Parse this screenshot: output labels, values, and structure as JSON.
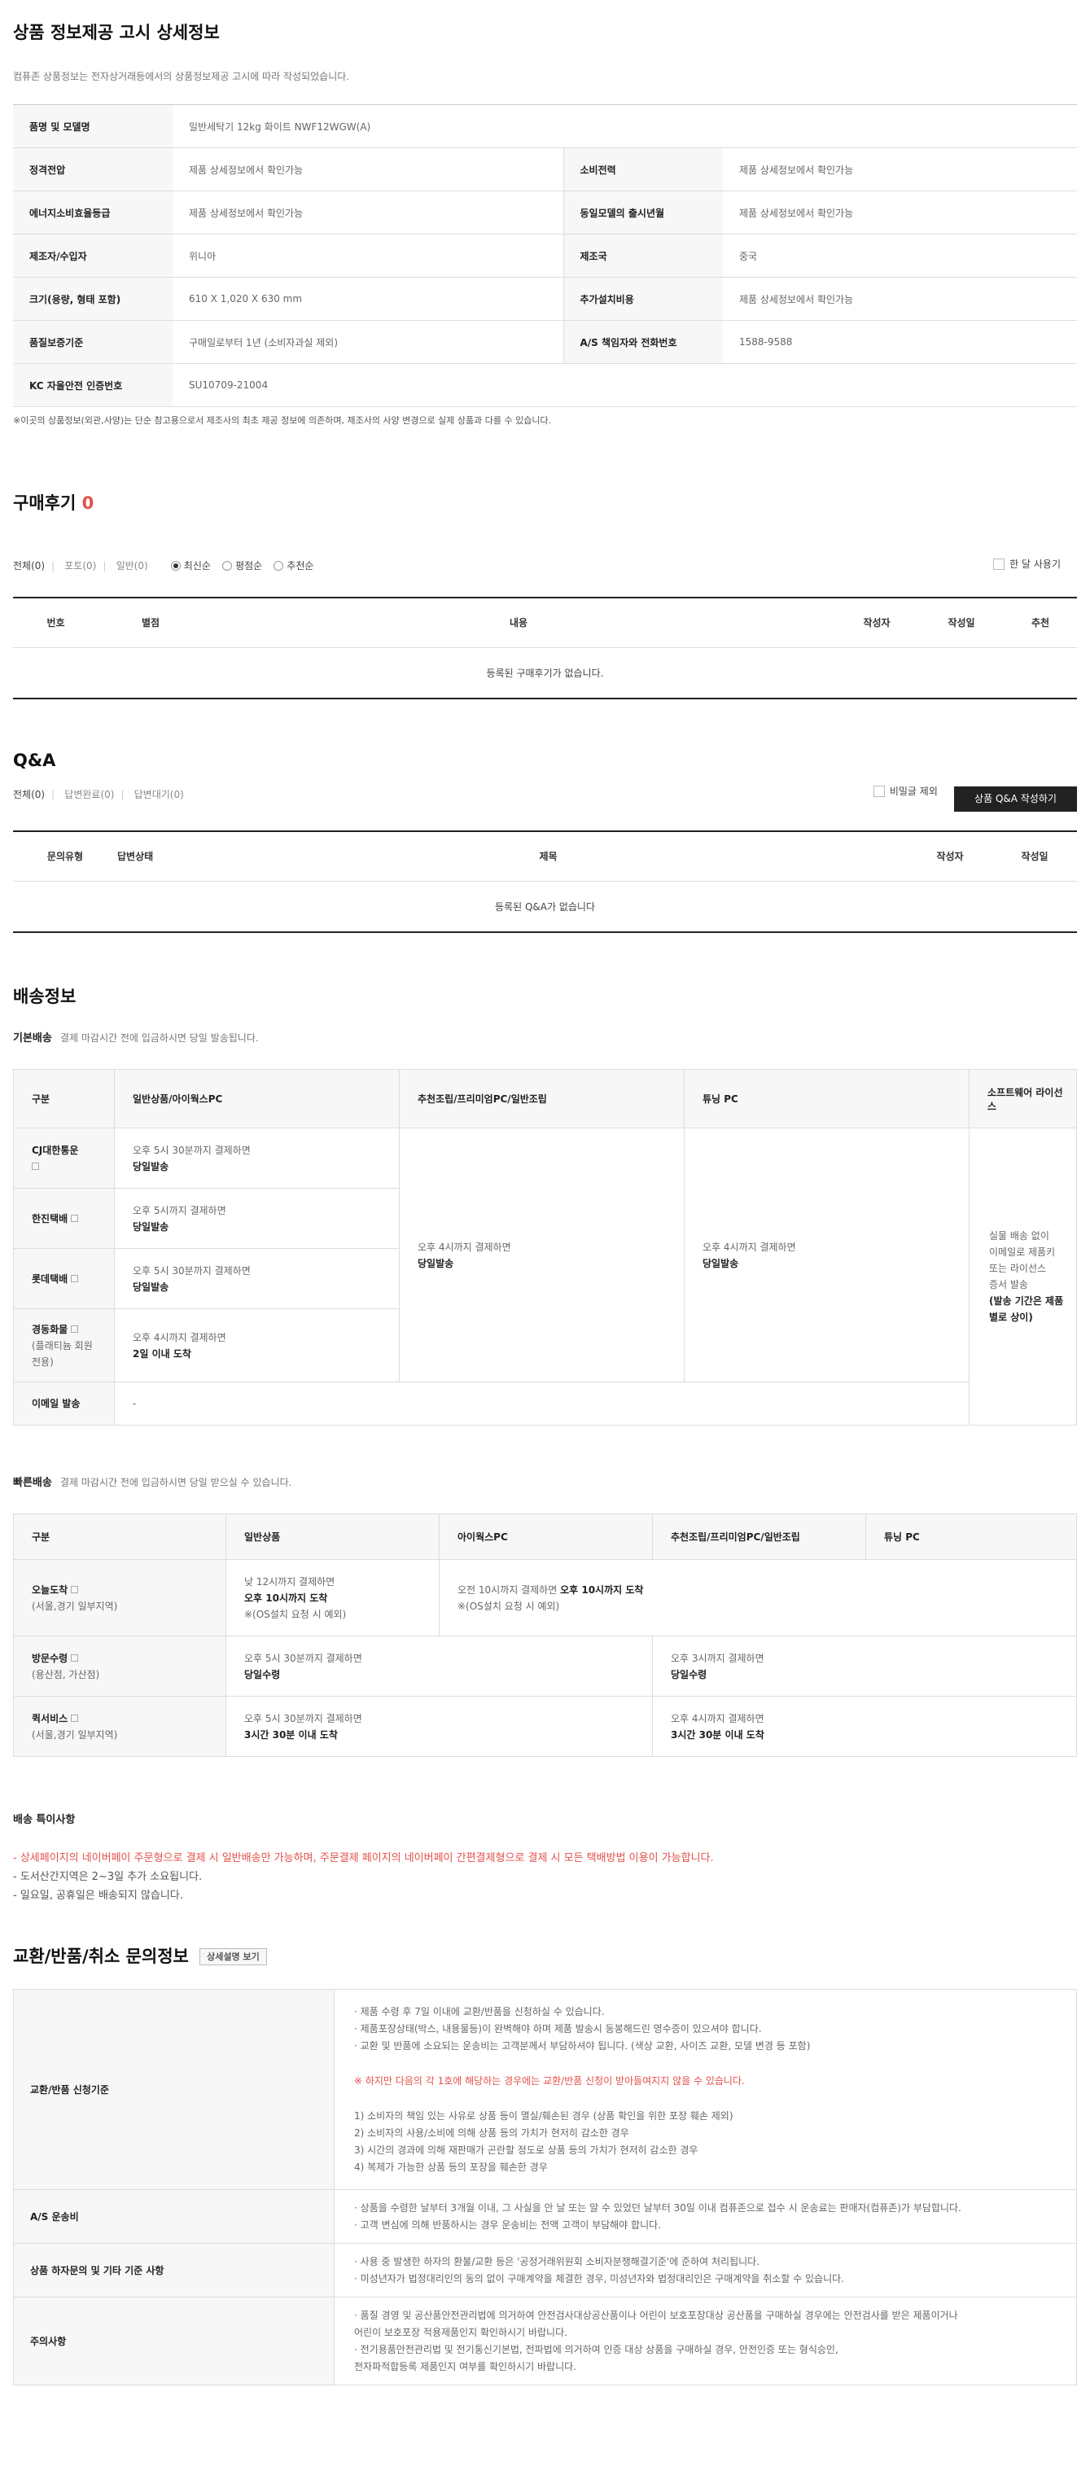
{
  "product_info": {
    "title": "상품 정보제공 고시 상세정보",
    "subtitle": "컴퓨존 상품정보는 전자상거래등에서의 상품정보제공 고시에 따라 작성되었습니다.",
    "model_label": "품명 및 모델명",
    "model_value": "일반세탁기 12kg 화이트 NWF12WGW(A)",
    "rows": [
      {
        "l1": "정격전압",
        "v1": "제품 상세정보에서 확인가능",
        "l2": "소비전력",
        "v2": "제품 상세정보에서 확인가능"
      },
      {
        "l1": "에너지소비효율등급",
        "v1": "제품 상세정보에서 확인가능",
        "l2": "동일모델의 출시년월",
        "v2": "제품 상세정보에서 확인가능"
      },
      {
        "l1": "제조자/수입자",
        "v1": "위니아",
        "l2": "제조국",
        "v2": "중국"
      },
      {
        "l1": "크기(용량, 형태 포함)",
        "v1": "610 X 1,020 X 630 mm",
        "l2": "추가설치비용",
        "v2": "제품 상세정보에서 확인가능"
      },
      {
        "l1": "품질보증기준",
        "v1": "구매일로부터 1년 (소비자과실 제외)",
        "l2": "A/S 책임자와 전화번호",
        "v2": "1588-9588"
      }
    ],
    "kc_label": "KC 자율안전 인증번호",
    "kc_value": "SU10709-21004",
    "note": "※이곳의 상품정보(외관,사양)는 단순 참고용으로서 제조사의 최초 제공 정보에 의존하며, 제조사의 사양 변경으로 실제 상품과 다를 수 있습니다."
  },
  "reviews": {
    "title": "구매후기",
    "count": "0",
    "tab_all": "전체(0)",
    "tab_photo": "포토(0)",
    "tab_normal": "일반(0)",
    "sort_latest": "최신순",
    "sort_rating": "평점순",
    "sort_recommend": "추천순",
    "month_filter": "한 달 사용기",
    "headers": [
      "번호",
      "별점",
      "내용",
      "작성자",
      "작성일",
      "추천"
    ],
    "empty": "등록된 구매후기가 없습니다."
  },
  "qna": {
    "title": "Q&A",
    "tab_all": "전체(0)",
    "tab_done": "답변완료(0)",
    "tab_wait": "답변대기(0)",
    "secret_filter": "비밀글 제외",
    "write_button": "상품 Q&A 작성하기",
    "headers": [
      "문의유형",
      "답변상태",
      "제목",
      "작성자",
      "작성일"
    ],
    "empty": "등록된 Q&A가 없습니다"
  },
  "delivery": {
    "title": "배송정보",
    "basic_label": "기본배송",
    "basic_desc": "결제 마감시간 전에 입금하시면 당일 발송됩니다.",
    "basic_headers": [
      "구분",
      "일반상품/아이웍스PC",
      "추천조립/프리미엄PC/일반조립",
      "튜닝 PC",
      "소프트웨어 라이선스"
    ],
    "cj": "CJ대한통운",
    "hanjin": "한진택배",
    "lotte": "롯데택배",
    "kyungdong": "경동화물",
    "kyungdong_sub": "(플래티늄 회원 전용)",
    "email": "이메일 발송",
    "email_value": "-",
    "t530": "오후 5시 30분까지 결제하면",
    "t5": "오후 5시까지 결제하면",
    "t4": "오후 4시까지 결제하면",
    "same_day": "당일발송",
    "two_day": "2일 이내 도착",
    "sw_lines": [
      "실물 배송 없이",
      "이메일로 제품키",
      "또는 라이선스",
      "증서 발송"
    ],
    "sw_bold": "(발송 기간은 제품별로 상이)",
    "fast_label": "빠른배송",
    "fast_desc": "결제 마감시간 전에 입금하시면 당일 받으실 수 있습니다.",
    "fast_headers": [
      "구분",
      "일반상품",
      "아이웍스PC",
      "추천조립/프리미엄PC/일반조립",
      "튜닝 PC"
    ],
    "today": "오늘도착",
    "today_sub": "(서울,경기 일부지역)",
    "visit": "방문수령",
    "visit_sub": "(용산점, 가산점)",
    "quick": "퀵서비스",
    "quick_sub": "(서울,경기 일부지역)",
    "t12": "낮 12시까지 결제하면",
    "arrive10": "오후 10시까지 도착",
    "os_note": "※(OS설치 요청 시 예외)",
    "am10": "오전 10시까지 결제하면",
    "pm3": "오후 3시까지 결제하면",
    "pickup": "당일수령",
    "h330": "3시간 30분 이내 도착",
    "special_title": "배송 특이사항",
    "special_red": "- 상세페이지의 네이버페이 주문형으로 결제 시 일반배송만 가능하며, 주문결제 페이지의 네이버페이 간편결제형으로 결제 시 모든 택배방법 이용이 가능합니다.",
    "special_1": "- 도서산간지역은 2~3일 추가 소요됩니다.",
    "special_2": "- 일요일, 공휴일은 배송되지 않습니다."
  },
  "exchange": {
    "title": "교환/반품/취소 문의정보",
    "detail_button": "상세설명 보기",
    "apply_label": "교환/반품 신청기준",
    "apply_lines": [
      "· 제품 수령 후 7일 이내에 교환/반품을 신청하실 수 있습니다.",
      "· 제품포장상태(박스, 내용물등)이 완벽해야 하며 제품 발송시 동봉해드린 영수증이 있으셔야 합니다.",
      "· 교환 및 반품에 소요되는 운송비는 고객분께서 부담하셔야 됩니다. (색상 교환, 사이즈 교환, 모델 변경 등 포함)"
    ],
    "apply_red": "※ 하지만 다음의 각 1호에 해당하는 경우에는 교환/반품 신청이 받아들여지지 않을 수 있습니다.",
    "apply_list": [
      "1) 소비자의 책임 있는 사유로 상품 등이 멸실/훼손된 경우 (상품 확인을 위한 포장 훼손 제외)",
      "2) 소비자의 사용/소비에 의해 상품 등의 가치가 현저히 감소한 경우",
      "3) 시간의 경과에 의해 재판매가 곤란할 정도로 상품 등의 가치가 현저히 감소한 경우",
      "4) 복제가 가능한 상품 등의 포장을 훼손한 경우"
    ],
    "as_label": "A/S 운송비",
    "as_lines": [
      "· 상품을 수령한 날부터 3개월 이내, 그 사실을 안 날 또는 알 수 있었던 날부터 30일 이내 컴퓨존으로 접수 시 운송료는 판매자(컴퓨존)가 부담합니다.",
      "· 고객 변심에 의해 반품하시는 경우 운송비는 전액 고객이 부담해야 합니다."
    ],
    "defect_label": "상품 하자문의 및 기타 기준 사항",
    "defect_lines": [
      "· 사용 중 발생한 하자의 환불/교환 등은 '공정거래위원회 소비자분쟁해결기준'에 준하여 처리됩니다.",
      "· 미성년자가 법정대리인의 동의 없이 구매계약을 체결한 경우, 미성년자와 법정대리인은 구매계약을 취소할 수 있습니다."
    ],
    "caution_label": "주의사항",
    "caution_lines": [
      "· 품질 경영 및 공산품안전관리법에 의거하여 안전검사대상공산품이나 어린이 보호포장대상 공산품을 구매하실 경우에는 안전검사를 받은 제품이거나",
      "어린이 보호포장 적용제품인지 확인하시기 바랍니다.",
      "· 전기용품안전관리법 및 전기통신기본법, 전파법에 의거하여 인증 대상 상품을 구매하실 경우, 안전인증 또는 형식승인,",
      "전자파적합등록 제품인지 여부를 확인하시기 바랍니다."
    ]
  }
}
